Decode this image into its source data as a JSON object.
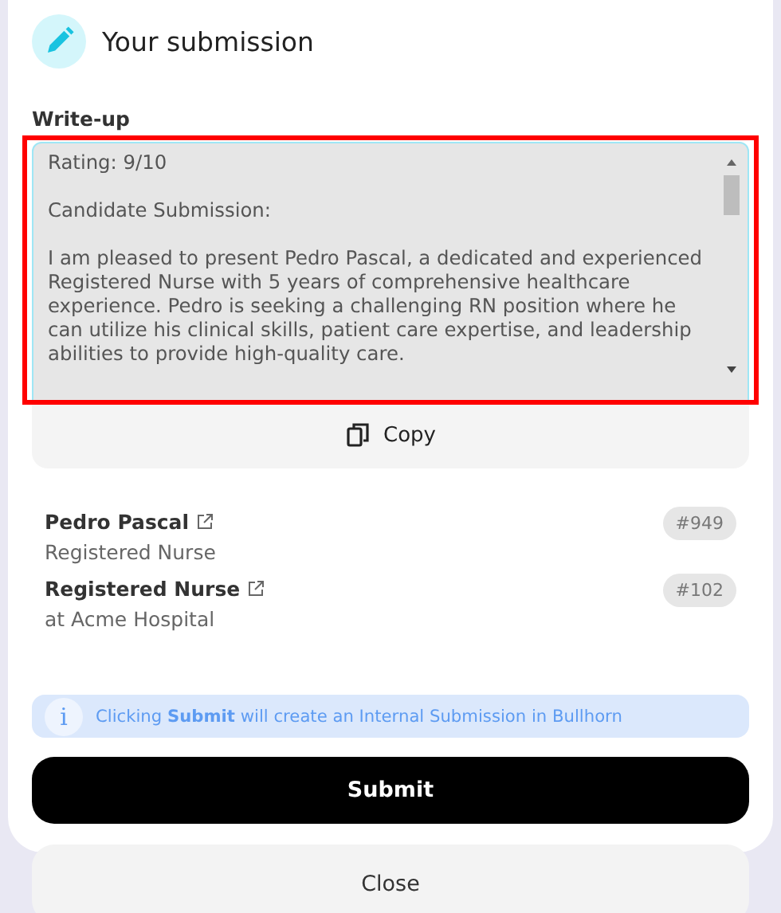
{
  "header": {
    "title": "Your submission"
  },
  "write_up": {
    "label": "Write-up",
    "lines": [
      "Rating: 9/10",
      "Candidate Submission:",
      "I am pleased to present Pedro Pascal, a dedicated and experienced Registered Nurse with 5 years of comprehensive healthcare experience. Pedro is seeking a challenging RN position where he can utilize his clinical skills, patient care expertise, and leadership abilities to provide high-quality care."
    ],
    "highlighted": true
  },
  "copy_button": "Copy",
  "records": [
    {
      "title": "Pedro Pascal",
      "subtitle": "Registered Nurse",
      "badge": "#949"
    },
    {
      "title": "Registered Nurse",
      "subtitle": "at Acme Hospital",
      "badge": "#102"
    }
  ],
  "info": {
    "icon": "i",
    "text": "Clicking **Submit** will create an Internal Submission in Bullhorn"
  },
  "buttons": [
    {
      "label": "Submit",
      "kind": "primary"
    },
    {
      "label": "Close",
      "kind": "secondary"
    }
  ]
}
